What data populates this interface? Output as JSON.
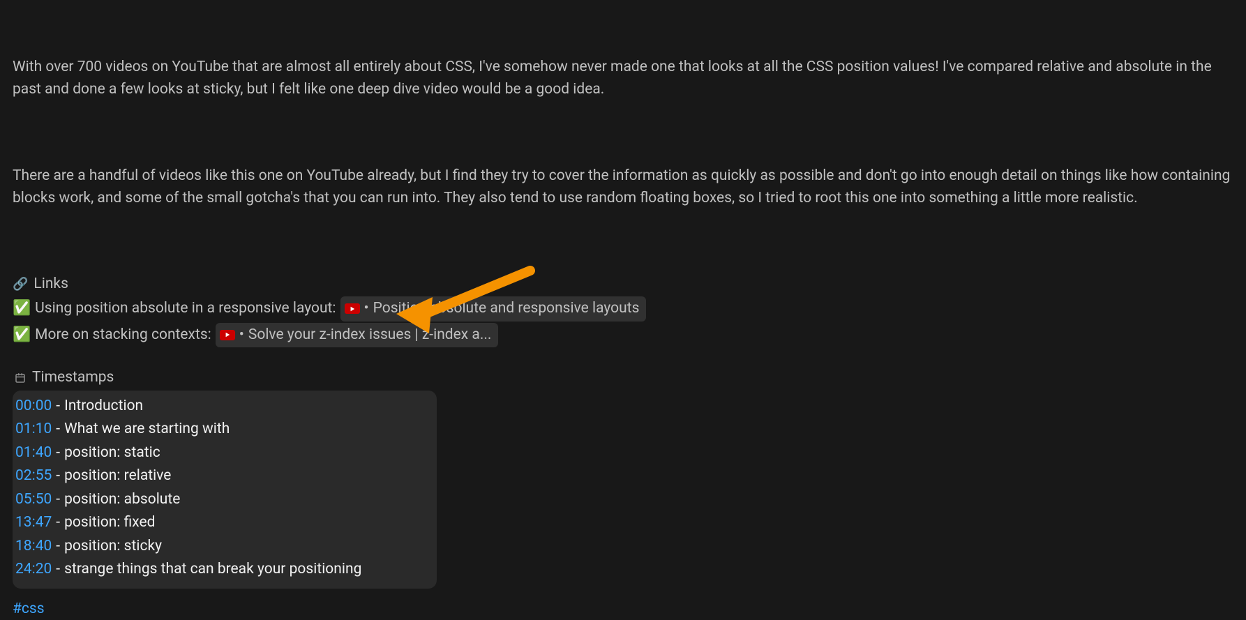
{
  "description": {
    "para1": "With over 700 videos on YouTube that are almost all entirely about CSS, I've somehow never made one that looks at all the CSS position values! I've compared relative and absolute in the past and done a few looks at sticky, but I felt like one deep dive video would be a good idea.",
    "para2": "There are a handful of videos like this one on YouTube already, but I find they try to cover the information as quickly as possible and don't go into enough detail on things like how containing blocks work, and some of the small gotcha's that you can run into. They also tend to use random floating boxes, so I tried to root this one into something a little more realistic."
  },
  "links": {
    "icon": "🔗",
    "header": "Links",
    "items": [
      {
        "check": "✅",
        "label": "Using position absolute in a responsive layout:",
        "chip_text": "Position absolute and responsive layouts"
      },
      {
        "check": "✅",
        "label": "More on stacking contexts:",
        "chip_text": "Solve your z-index issues | z-index a..."
      }
    ]
  },
  "timestamps": {
    "icon": "⌚",
    "header": "Timestamps",
    "items": [
      {
        "time": "00:00",
        "label": "Introduction"
      },
      {
        "time": "01:10",
        "label": "What we are starting with"
      },
      {
        "time": "01:40",
        "label": "position: static"
      },
      {
        "time": "02:55",
        "label": "position: relative"
      },
      {
        "time": "05:50",
        "label": "position: absolute"
      },
      {
        "time": "13:47",
        "label": "position: fixed"
      },
      {
        "time": "18:40",
        "label": "position: sticky"
      },
      {
        "time": "24:20",
        "label": "strange things that can break your positioning"
      }
    ]
  },
  "hashtag": "#css",
  "chip_bullet": "•",
  "ts_sep": "-"
}
